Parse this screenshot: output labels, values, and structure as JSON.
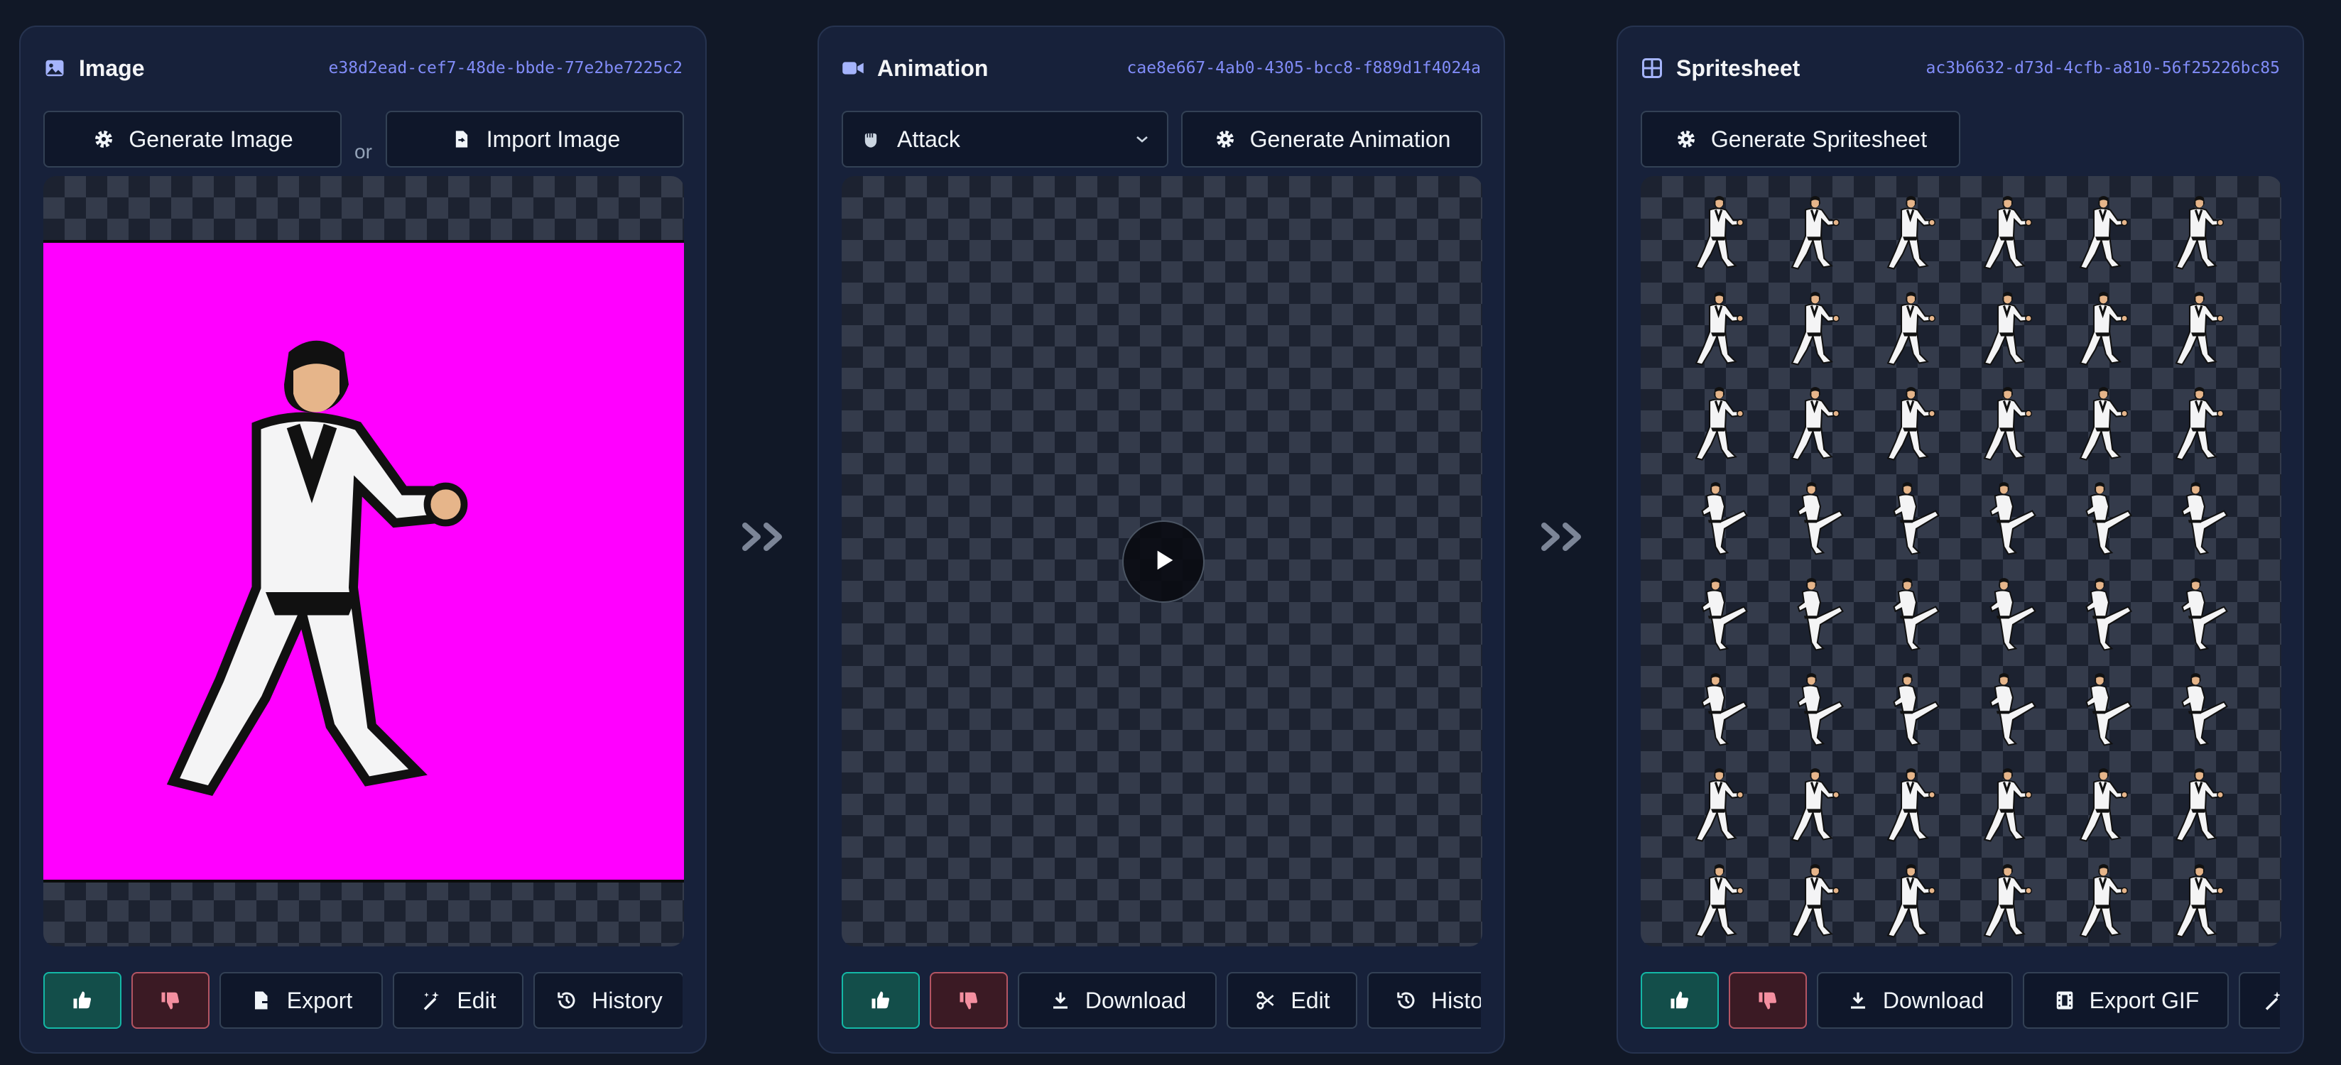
{
  "panels": {
    "image": {
      "title": "Image",
      "id": "e38d2ead-cef7-48de-bbde-77e2be7225c2",
      "generate_label": "Generate Image",
      "or_label": "or",
      "import_label": "Import Image",
      "actions": {
        "export": "Export",
        "edit": "Edit",
        "history": "History"
      }
    },
    "animation": {
      "title": "Animation",
      "id": "cae8e667-4ab0-4305-bcc8-f889d1f4024a",
      "selected_action": "Attack",
      "generate_label": "Generate Animation",
      "actions": {
        "download": "Download",
        "edit": "Edit",
        "history": "History"
      }
    },
    "spritesheet": {
      "title": "Spritesheet",
      "id": "ac3b6632-d73d-4cfb-a810-56f25226bc85",
      "generate_label": "Generate Spritesheet",
      "actions": {
        "download": "Download",
        "export_gif": "Export GIF"
      }
    }
  },
  "colors": {
    "accent": "#818cf8",
    "chroma_key": "#ff00ff",
    "like": "#14b8a6",
    "dislike": "#b45563"
  },
  "icons": [
    "image-icon",
    "video-icon",
    "grid-icon",
    "gear-icon",
    "file-import-icon",
    "fist-icon",
    "chevron-down-icon",
    "play-icon",
    "thumbs-up-icon",
    "thumbs-down-icon",
    "export-icon",
    "magic-wand-icon",
    "history-icon",
    "download-icon",
    "scissors-icon",
    "film-icon",
    "double-chevron-right-icon"
  ],
  "spritesheet_grid": {
    "columns": 6,
    "rows": 8
  }
}
